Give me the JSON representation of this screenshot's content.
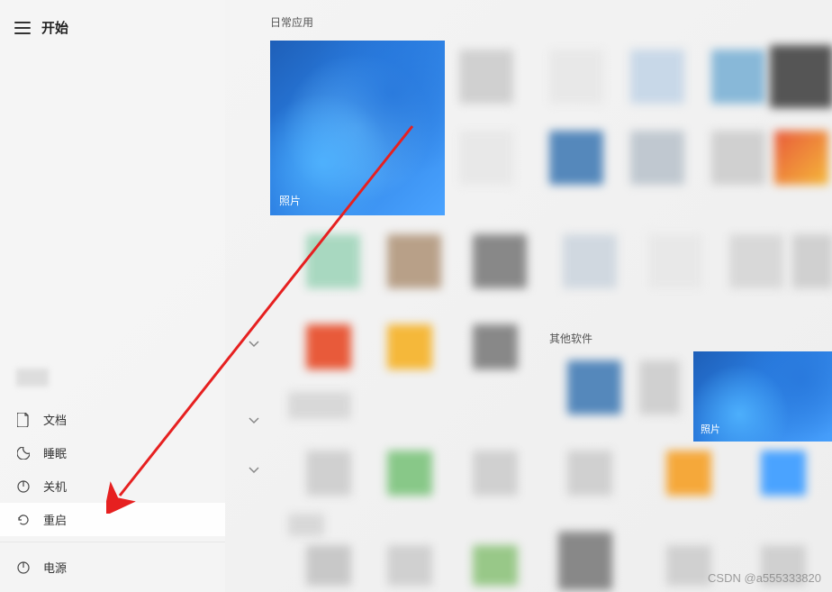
{
  "sidebar": {
    "title": "开始",
    "menu": {
      "documents": "文档",
      "sleep": "睡眠",
      "shutdown": "关机",
      "restart": "重启",
      "power": "电源"
    }
  },
  "main": {
    "section_daily": "日常应用",
    "section_other": "其他软件",
    "photo_label": "照片"
  },
  "watermark": "CSDN @a555333820"
}
